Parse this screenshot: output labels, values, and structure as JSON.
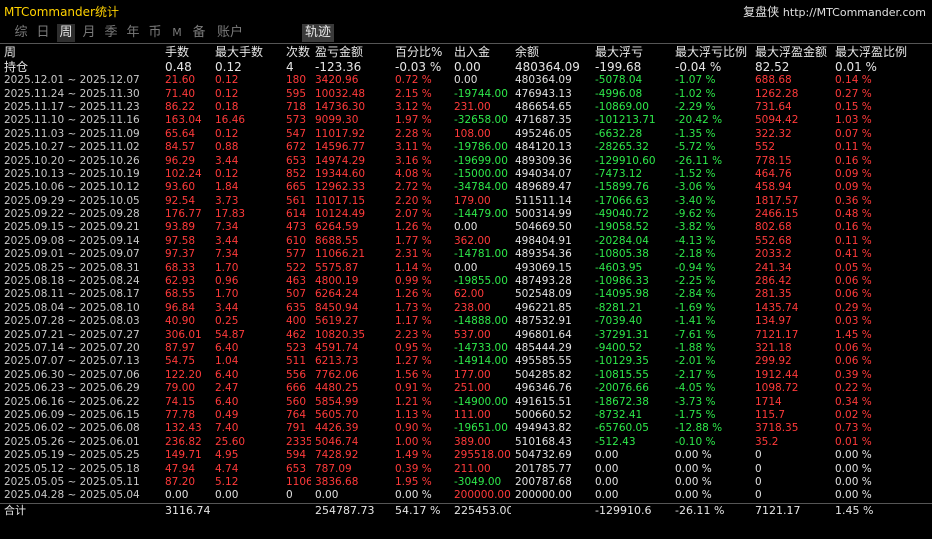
{
  "app_title": "MTCommander统计",
  "brand": {
    "name": "复盘侠",
    "url": "http://MTCommander.com"
  },
  "tabs": [
    {
      "label": "综",
      "active": false
    },
    {
      "label": "日",
      "active": false
    },
    {
      "label": "周",
      "active": true
    },
    {
      "label": "月",
      "active": false
    },
    {
      "label": "季",
      "active": false
    },
    {
      "label": "年",
      "active": false
    },
    {
      "label": "币",
      "active": false
    },
    {
      "label": "M",
      "active": false
    },
    {
      "label": "备",
      "active": false
    },
    {
      "label": "账户",
      "active": false
    },
    {
      "label": "轨迹",
      "active": false
    }
  ],
  "columns": [
    "周",
    "手数",
    "最大手数",
    "次数",
    "盈亏金额",
    "百分比%",
    "出入金",
    "余额",
    "最大浮亏",
    "最大浮亏比例",
    "最大浮盈金额",
    "最大浮盈比例"
  ],
  "holding": [
    "持仓",
    "0.48",
    "0.12",
    "4",
    "-123.36",
    "-0.03 %",
    "0.00",
    "480364.09",
    "-199.68",
    "-0.04 %",
    "82.52",
    "0.01 %"
  ],
  "rows": [
    [
      "2025.12.01 ~ 2025.12.07",
      "21.60",
      "0.12",
      "180",
      "3420.96",
      "0.72 %",
      "0.00",
      "480364.09",
      "-5078.04",
      "-1.07 %",
      "688.68",
      "0.14 %"
    ],
    [
      "2025.11.24 ~ 2025.11.30",
      "71.40",
      "0.12",
      "595",
      "10032.48",
      "2.15 %",
      "-19744.00",
      "476943.13",
      "-4996.08",
      "-1.02 %",
      "1262.28",
      "0.27 %"
    ],
    [
      "2025.11.17 ~ 2025.11.23",
      "86.22",
      "0.18",
      "718",
      "14736.30",
      "3.12 %",
      "231.00",
      "486654.65",
      "-10869.00",
      "-2.29 %",
      "731.64",
      "0.15 %"
    ],
    [
      "2025.11.10 ~ 2025.11.16",
      "163.04",
      "16.46",
      "573",
      "9099.30",
      "1.97 %",
      "-32658.00",
      "471687.35",
      "-101213.71",
      "-20.42 %",
      "5094.42",
      "1.03 %"
    ],
    [
      "2025.11.03 ~ 2025.11.09",
      "65.64",
      "0.12",
      "547",
      "11017.92",
      "2.28 %",
      "108.00",
      "495246.05",
      "-6632.28",
      "-1.35 %",
      "322.32",
      "0.07 %"
    ],
    [
      "2025.10.27 ~ 2025.11.02",
      "84.57",
      "0.88",
      "672",
      "14596.77",
      "3.11 %",
      "-19786.00",
      "484120.13",
      "-28265.32",
      "-5.72 %",
      "552",
      "0.11 %"
    ],
    [
      "2025.10.20 ~ 2025.10.26",
      "96.29",
      "3.44",
      "653",
      "14974.29",
      "3.16 %",
      "-19699.00",
      "489309.36",
      "-129910.60",
      "-26.11 %",
      "778.15",
      "0.16 %"
    ],
    [
      "2025.10.13 ~ 2025.10.19",
      "102.24",
      "0.12",
      "852",
      "19344.60",
      "4.08 %",
      "-15000.00",
      "494034.07",
      "-7473.12",
      "-1.52 %",
      "464.76",
      "0.09 %"
    ],
    [
      "2025.10.06 ~ 2025.10.12",
      "93.60",
      "1.84",
      "665",
      "12962.33",
      "2.72 %",
      "-34784.00",
      "489689.47",
      "-15899.76",
      "-3.06 %",
      "458.94",
      "0.09 %"
    ],
    [
      "2025.09.29 ~ 2025.10.05",
      "92.54",
      "3.73",
      "561",
      "11017.15",
      "2.20 %",
      "179.00",
      "511511.14",
      "-17066.63",
      "-3.40 %",
      "1817.57",
      "0.36 %"
    ],
    [
      "2025.09.22 ~ 2025.09.28",
      "176.77",
      "17.83",
      "614",
      "10124.49",
      "2.07 %",
      "-14479.00",
      "500314.99",
      "-49040.72",
      "-9.62 %",
      "2466.15",
      "0.48 %"
    ],
    [
      "2025.09.15 ~ 2025.09.21",
      "93.89",
      "7.34",
      "473",
      "6264.59",
      "1.26 %",
      "0.00",
      "504669.50",
      "-19058.52",
      "-3.82 %",
      "802.68",
      "0.16 %"
    ],
    [
      "2025.09.08 ~ 2025.09.14",
      "97.58",
      "3.44",
      "610",
      "8688.55",
      "1.77 %",
      "362.00",
      "498404.91",
      "-20284.04",
      "-4.13 %",
      "552.68",
      "0.11 %"
    ],
    [
      "2025.09.01 ~ 2025.09.07",
      "97.37",
      "7.34",
      "577",
      "11066.21",
      "2.31 %",
      "-14781.00",
      "489354.36",
      "-10805.38",
      "-2.18 %",
      "2033.2",
      "0.41 %"
    ],
    [
      "2025.08.25 ~ 2025.08.31",
      "68.33",
      "1.70",
      "522",
      "5575.87",
      "1.14 %",
      "0.00",
      "493069.15",
      "-4603.95",
      "-0.94 %",
      "241.34",
      "0.05 %"
    ],
    [
      "2025.08.18 ~ 2025.08.24",
      "62.93",
      "0.96",
      "463",
      "4800.19",
      "0.99 %",
      "-19855.00",
      "487493.28",
      "-10986.33",
      "-2.25 %",
      "286.42",
      "0.06 %"
    ],
    [
      "2025.08.11 ~ 2025.08.17",
      "68.55",
      "1.70",
      "507",
      "6264.24",
      "1.26 %",
      "62.00",
      "502548.09",
      "-14095.98",
      "-2.84 %",
      "281.35",
      "0.06 %"
    ],
    [
      "2025.08.04 ~ 2025.08.10",
      "96.84",
      "3.44",
      "635",
      "8450.94",
      "1.73 %",
      "238.00",
      "496221.85",
      "-8281.21",
      "-1.69 %",
      "1435.74",
      "0.29 %"
    ],
    [
      "2025.07.28 ~ 2025.08.03",
      "40.90",
      "0.25",
      "400",
      "5619.27",
      "1.17 %",
      "-14888.00",
      "487532.91",
      "-7039.40",
      "-1.41 %",
      "134.97",
      "0.03 %"
    ],
    [
      "2025.07.21 ~ 2025.07.27",
      "306.01",
      "54.87",
      "462",
      "10820.35",
      "2.23 %",
      "537.00",
      "496801.64",
      "-37291.31",
      "-7.61 %",
      "7121.17",
      "1.45 %"
    ],
    [
      "2025.07.14 ~ 2025.07.20",
      "87.97",
      "6.40",
      "523",
      "4591.74",
      "0.95 %",
      "-14733.00",
      "485444.29",
      "-9400.52",
      "-1.88 %",
      "321.18",
      "0.06 %"
    ],
    [
      "2025.07.07 ~ 2025.07.13",
      "54.75",
      "1.04",
      "511",
      "6213.73",
      "1.27 %",
      "-14914.00",
      "495585.55",
      "-10129.35",
      "-2.01 %",
      "299.92",
      "0.06 %"
    ],
    [
      "2025.06.30 ~ 2025.07.06",
      "122.20",
      "6.40",
      "556",
      "7762.06",
      "1.56 %",
      "177.00",
      "504285.82",
      "-10815.55",
      "-2.17 %",
      "1912.44",
      "0.39 %"
    ],
    [
      "2025.06.23 ~ 2025.06.29",
      "79.00",
      "2.47",
      "666",
      "4480.25",
      "0.91 %",
      "251.00",
      "496346.76",
      "-20076.66",
      "-4.05 %",
      "1098.72",
      "0.22 %"
    ],
    [
      "2025.06.16 ~ 2025.06.22",
      "74.15",
      "6.40",
      "560",
      "5854.99",
      "1.21 %",
      "-14900.00",
      "491615.51",
      "-18672.38",
      "-3.73 %",
      "1714",
      "0.34 %"
    ],
    [
      "2025.06.09 ~ 2025.06.15",
      "77.78",
      "0.49",
      "764",
      "5605.70",
      "1.13 %",
      "111.00",
      "500660.52",
      "-8732.41",
      "-1.75 %",
      "115.7",
      "0.02 %"
    ],
    [
      "2025.06.02 ~ 2025.06.08",
      "132.43",
      "7.40",
      "791",
      "4426.39",
      "0.90 %",
      "-19651.00",
      "494943.82",
      "-65760.05",
      "-12.88 %",
      "3718.35",
      "0.73 %"
    ],
    [
      "2025.05.26 ~ 2025.06.01",
      "236.82",
      "25.60",
      "2335",
      "5046.74",
      "1.00 %",
      "389.00",
      "510168.43",
      "-512.43",
      "-0.10 %",
      "35.2",
      "0.01 %"
    ],
    [
      "2025.05.19 ~ 2025.05.25",
      "149.71",
      "4.95",
      "594",
      "7428.92",
      "1.49 %",
      "295518.00",
      "504732.69",
      "0.00",
      "0.00 %",
      "0",
      "0.00 %"
    ],
    [
      "2025.05.12 ~ 2025.05.18",
      "47.94",
      "4.74",
      "653",
      "787.09",
      "0.39 %",
      "211.00",
      "201785.77",
      "0.00",
      "0.00 %",
      "0",
      "0.00 %"
    ],
    [
      "2025.05.05 ~ 2025.05.11",
      "87.20",
      "5.12",
      "1106",
      "3836.68",
      "1.95 %",
      "-3049.00",
      "200787.68",
      "0.00",
      "0.00 %",
      "0",
      "0.00 %"
    ],
    [
      "2025.04.28 ~ 2025.05.04",
      "0.00",
      "0.00",
      "0",
      "0.00",
      "0.00 %",
      "200000.00",
      "200000.00",
      "0.00",
      "0.00 %",
      "0",
      "0.00 %"
    ]
  ],
  "total": [
    "合计",
    "3116.74",
    "",
    "",
    "254787.73",
    "54.17 %",
    "225453.00",
    "",
    "-129910.6",
    "-26.11 %",
    "7121.17",
    "1.45 %"
  ]
}
